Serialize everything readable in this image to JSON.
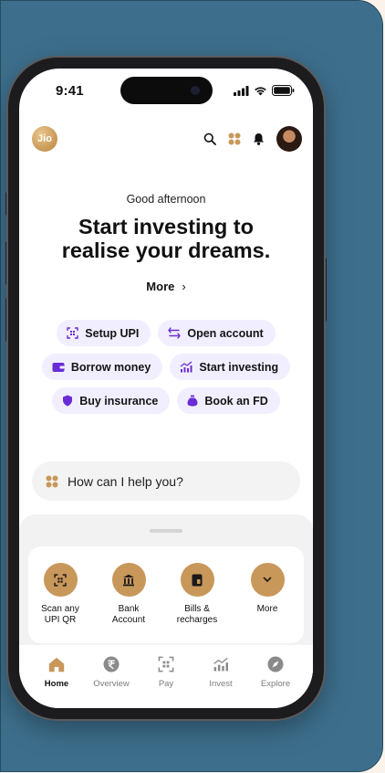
{
  "status_bar": {
    "time": "9:41"
  },
  "header": {
    "logo_text": "Jio",
    "icons": [
      "search-icon",
      "apps-grid-icon",
      "bell-icon",
      "avatar"
    ]
  },
  "hero": {
    "greeting": "Good afternoon",
    "headline_line1": "Start investing to",
    "headline_line2": "realise your dreams.",
    "more_label": "More",
    "more_chevron": "›"
  },
  "chips": [
    {
      "label": "Setup UPI",
      "icon": "qr-scan-icon"
    },
    {
      "label": "Open account",
      "icon": "swap-arrows-icon"
    },
    {
      "label": "Borrow money",
      "icon": "wallet-icon"
    },
    {
      "label": "Start investing",
      "icon": "growth-chart-icon"
    },
    {
      "label": "Buy insurance",
      "icon": "shield-icon"
    },
    {
      "label": "Book an FD",
      "icon": "money-bag-icon"
    }
  ],
  "assistant": {
    "placeholder": "How can I help you?"
  },
  "quick_actions": [
    {
      "line1": "Scan any",
      "line2": "UPI QR",
      "icon": "qr-scan-icon"
    },
    {
      "line1": "Bank",
      "line2": "Account",
      "icon": "bank-icon"
    },
    {
      "line1": "Bills &",
      "line2": "recharges",
      "icon": "bill-icon"
    },
    {
      "line1": "More",
      "line2": "",
      "icon": "chevron-down-icon"
    }
  ],
  "tabs": [
    {
      "label": "Home",
      "icon": "home-icon",
      "active": true
    },
    {
      "label": "Overview",
      "icon": "rupee-icon",
      "active": false
    },
    {
      "label": "Pay",
      "icon": "qr-scan-icon",
      "active": false
    },
    {
      "label": "Invest",
      "icon": "growth-chart-icon",
      "active": false
    },
    {
      "label": "Explore",
      "icon": "compass-icon",
      "active": false
    }
  ],
  "colors": {
    "panel": "#3d6f8c",
    "accent_gold": "#c8975a",
    "chip_bg": "#f1efff",
    "chip_icon_purple": "#6a2cd6",
    "page_bg": "#fbf3ea"
  }
}
